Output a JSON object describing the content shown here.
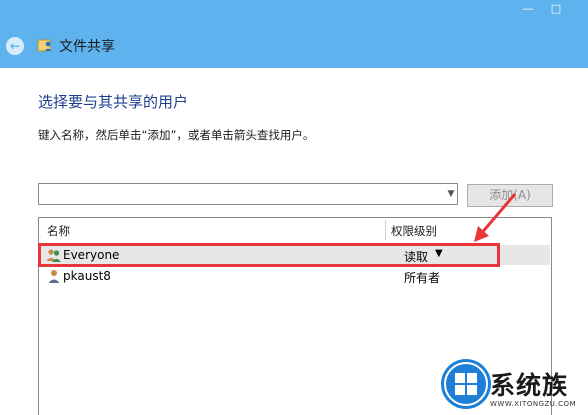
{
  "window": {
    "title": "文件共享",
    "minimize_glyph": "—",
    "maximize_glyph": "□",
    "back_glyph": "←"
  },
  "content": {
    "heading": "选择要与其共享的用户",
    "instruction": "键入名称，然后单击“添加”，或者单击箭头查找用户。"
  },
  "name_input": {
    "value": "",
    "placeholder": "",
    "dropdown_glyph": "▼"
  },
  "add_button": {
    "label": "添加(A)"
  },
  "table": {
    "headers": {
      "name": "名称",
      "permission": "权限级别"
    },
    "rows": [
      {
        "name": "Everyone",
        "permission": "读取",
        "icon": "group-users-icon",
        "dropdown": "▼"
      },
      {
        "name": "pkaust8",
        "permission": "所有者",
        "icon": "user-icon"
      }
    ]
  },
  "watermark": {
    "text": "系统族",
    "url": "WWW.XITONGZU.COM"
  },
  "colors": {
    "titlebar": "#5eb3ee",
    "heading": "#1e3f8f",
    "highlight": "#e8353a",
    "selected_row": "#e7e7e7"
  }
}
